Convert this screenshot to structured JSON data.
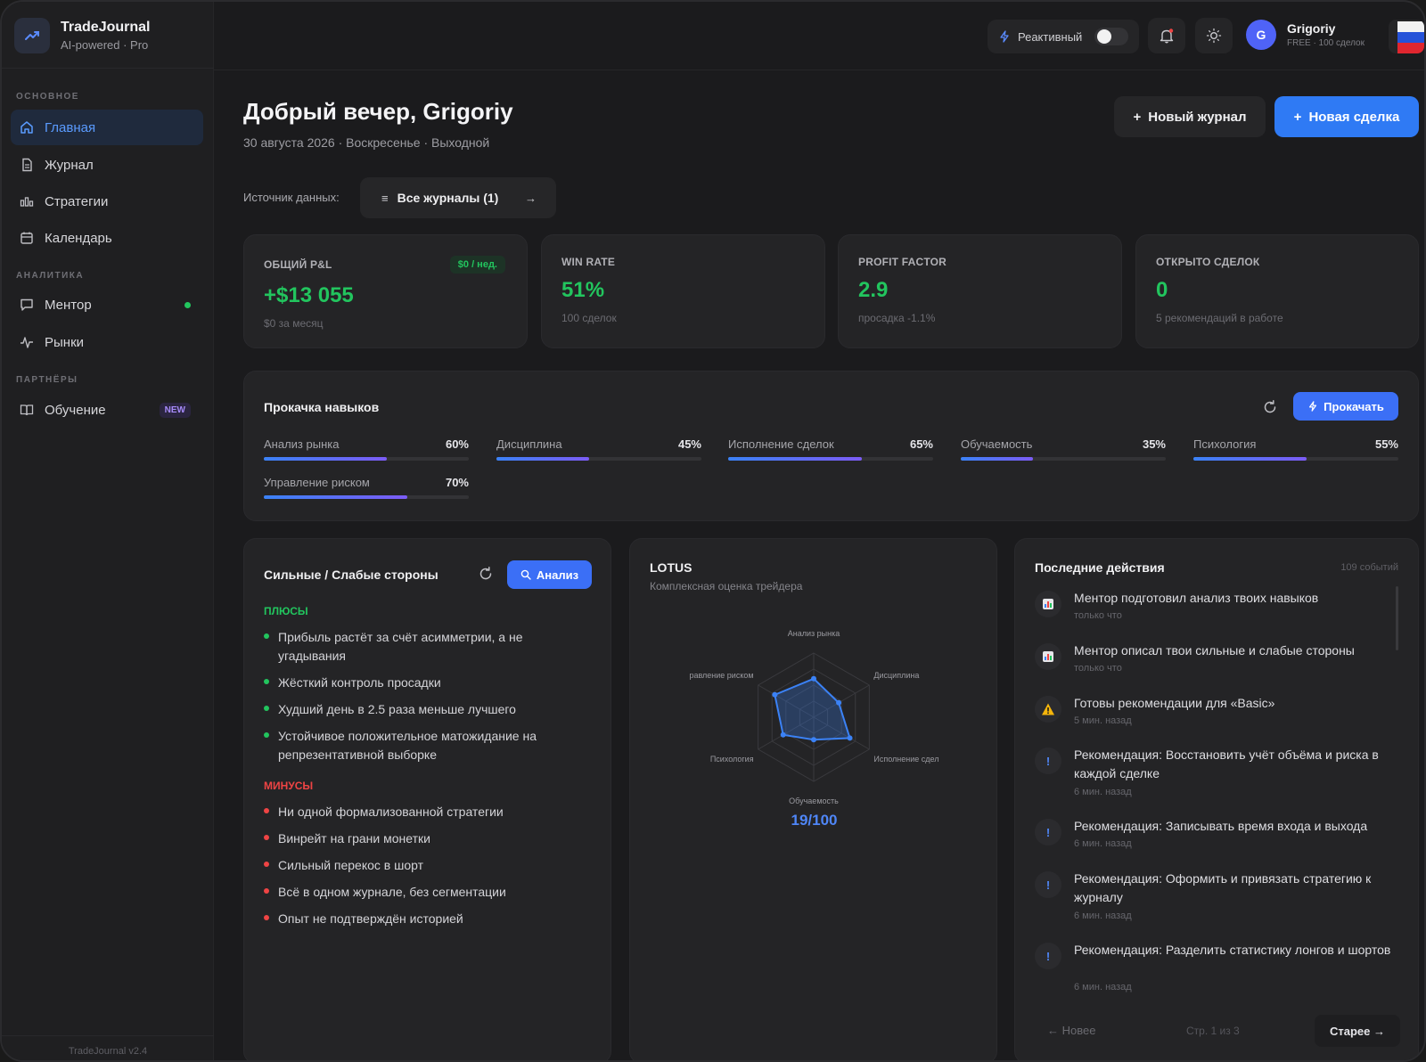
{
  "app": {
    "name": "TradeJournal",
    "subtitle": "AI-powered · Pro",
    "version": "TradeJournal v2.4"
  },
  "sidebar": {
    "sections": {
      "main": "ОСНОВНОЕ",
      "analytics": "АНАЛИТИКА",
      "partners": "ПАРТНЁРЫ"
    },
    "items": [
      {
        "label": "Главная",
        "icon": "home-icon",
        "active": true
      },
      {
        "label": "Журнал",
        "icon": "file-icon"
      },
      {
        "label": "Стратегии",
        "icon": "chart-bars-icon"
      },
      {
        "label": "Календарь",
        "icon": "calendar-icon"
      },
      {
        "label": "Ментор",
        "icon": "message-icon",
        "status_dot": true
      },
      {
        "label": "Рынки",
        "icon": "pulse-icon"
      },
      {
        "label": "Обучение",
        "icon": "book-icon",
        "badge": "NEW"
      }
    ]
  },
  "topbar": {
    "reactive_label": "Реактивный",
    "user": {
      "initial": "G",
      "name": "Grigoriy",
      "plan": "FREE · 100 сделок"
    }
  },
  "header": {
    "greeting": "Добрый вечер, Grigoriy",
    "date": "30 августа 2026 · Воскресенье · Выходной",
    "new_journal": "Новый журнал",
    "new_trade": "Новая сделка",
    "source_label": "Источник данных:",
    "source_value": "Все журналы (1)"
  },
  "stats": [
    {
      "label": "ОБЩИЙ P&L",
      "value": "+$13 055",
      "sub": "$0 за месяц",
      "pill": "$0 / нед."
    },
    {
      "label": "WIN RATE",
      "value": "51%",
      "sub": "100 сделок"
    },
    {
      "label": "PROFIT FACTOR",
      "value": "2.9",
      "sub": "просадка -1.1%"
    },
    {
      "label": "ОТКРЫТО СДЕЛОК",
      "value": "0",
      "sub": "5 рекомендаций в работе"
    }
  ],
  "skills": {
    "title": "Прокачка навыков",
    "button": "Прокачать",
    "items": [
      {
        "name": "Анализ рынка",
        "pct": 60,
        "label": "60%"
      },
      {
        "name": "Дисциплина",
        "pct": 45,
        "label": "45%"
      },
      {
        "name": "Исполнение сделок",
        "pct": 65,
        "label": "65%"
      },
      {
        "name": "Обучаемость",
        "pct": 35,
        "label": "35%"
      },
      {
        "name": "Психология",
        "pct": 55,
        "label": "55%"
      },
      {
        "name": "Управление риском",
        "pct": 70,
        "label": "70%"
      }
    ]
  },
  "strengths": {
    "title": "Сильные / Слабые стороны",
    "button": "Анализ",
    "plus_head": "ПЛЮСЫ",
    "minus_head": "МИНУСЫ",
    "plus": [
      "Прибыль растёт за счёт асимметрии, а не угадывания",
      "Жёсткий контроль просадки",
      "Худший день в 2.5 раза меньше лучшего",
      "Устойчивое положительное матожидание на репрезентативной выборке"
    ],
    "minus": [
      "Ни одной формализованной стратегии",
      "Винрейт на грани монетки",
      "Сильный перекос в шорт",
      "Всё в одном журнале, без сегментации",
      "Опыт не подтверждён историей"
    ]
  },
  "lotus": {
    "title": "LOTUS",
    "subtitle": "Комплексная оценка трейдера",
    "axes": [
      "Анализ рынка",
      "Дисциплина",
      "Исполнение сдел",
      "Обучаемость",
      "Психология",
      "равление риском"
    ],
    "values": [
      60,
      45,
      65,
      35,
      55,
      70
    ],
    "score": "19/100"
  },
  "activity": {
    "title": "Последние действия",
    "count": "109 событий",
    "items": [
      {
        "icon": "chart-emoji-icon",
        "title": "Ментор подготовил анализ твоих навыков",
        "time": "только что"
      },
      {
        "icon": "chart-emoji-icon",
        "title": "Ментор описал твои сильные и слабые стороны",
        "time": "только что"
      },
      {
        "icon": "warning-icon",
        "title": "Готовы рекомендации для «Basic»",
        "time": "5 мин. назад"
      },
      {
        "icon": "info-icon",
        "title": "Рекомендация: Восстановить учёт объёма и риска в каждой сделке",
        "time": "6 мин. назад"
      },
      {
        "icon": "info-icon",
        "title": "Рекомендация: Записывать время входа и выхода",
        "time": "6 мин. назад"
      },
      {
        "icon": "info-icon",
        "title": "Рекомендация: Оформить и привязать стратегию к журналу",
        "time": "6 мин. назад"
      },
      {
        "icon": "info-icon",
        "title": "Рекомендация: Разделить статистику лонгов и шортов",
        "time": "6 мин. назад"
      }
    ],
    "prev": "← Новее",
    "page": "Стр. 1 из 3",
    "next": "Старее →"
  },
  "colors": {
    "accent": "#2f7af4",
    "positive": "#22c55e",
    "negative": "#ef4444",
    "background": "#1b1b1d",
    "card": "#242426"
  }
}
